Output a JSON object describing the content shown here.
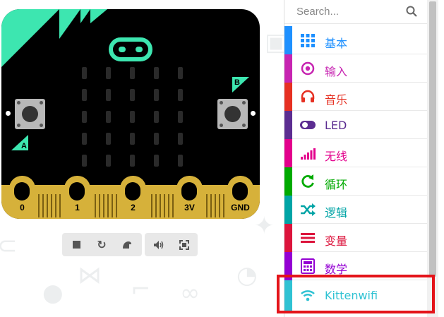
{
  "simulator": {
    "board": {
      "button_a_label": "A",
      "button_b_label": "B",
      "pins": [
        "0",
        "1",
        "2",
        "3V",
        "GND"
      ]
    },
    "toolbar": [
      {
        "icon": "stop-icon",
        "glyph": "■"
      },
      {
        "icon": "restart-icon",
        "glyph": "↻"
      },
      {
        "icon": "slow-mo-icon",
        "glyph": "🐢"
      },
      {
        "icon": "mute-icon",
        "glyph": "🔊"
      },
      {
        "icon": "fullscreen-icon",
        "glyph": "⛶"
      }
    ],
    "colors": {
      "board": "#000000",
      "accent": "#3de6b0",
      "edge": "#d6b13a"
    }
  },
  "toolbox": {
    "search": {
      "placeholder": "Search..."
    },
    "categories": [
      {
        "label": "基本",
        "icon": "grid-icon",
        "color": "#1e90ff"
      },
      {
        "label": "输入",
        "icon": "target-icon",
        "color": "#c724b1"
      },
      {
        "label": "音乐",
        "icon": "headphones-icon",
        "color": "#e63022"
      },
      {
        "label": "LED",
        "icon": "toggle-icon",
        "color": "#5c2d91"
      },
      {
        "label": "无线",
        "icon": "signal-bars-icon",
        "color": "#e3008c"
      },
      {
        "label": "循环",
        "icon": "loop-arrow-icon",
        "color": "#00aa00"
      },
      {
        "label": "逻辑",
        "icon": "shuffle-icon",
        "color": "#00a4a6"
      },
      {
        "label": "变量",
        "icon": "list-lines-icon",
        "color": "#dc143c"
      },
      {
        "label": "数学",
        "icon": "calculator-icon",
        "color": "#9400d3"
      },
      {
        "label": "Kittenwifi",
        "icon": "wifi-icon",
        "color": "#2fc2d3"
      }
    ],
    "highlight_color": "#e4141a"
  }
}
